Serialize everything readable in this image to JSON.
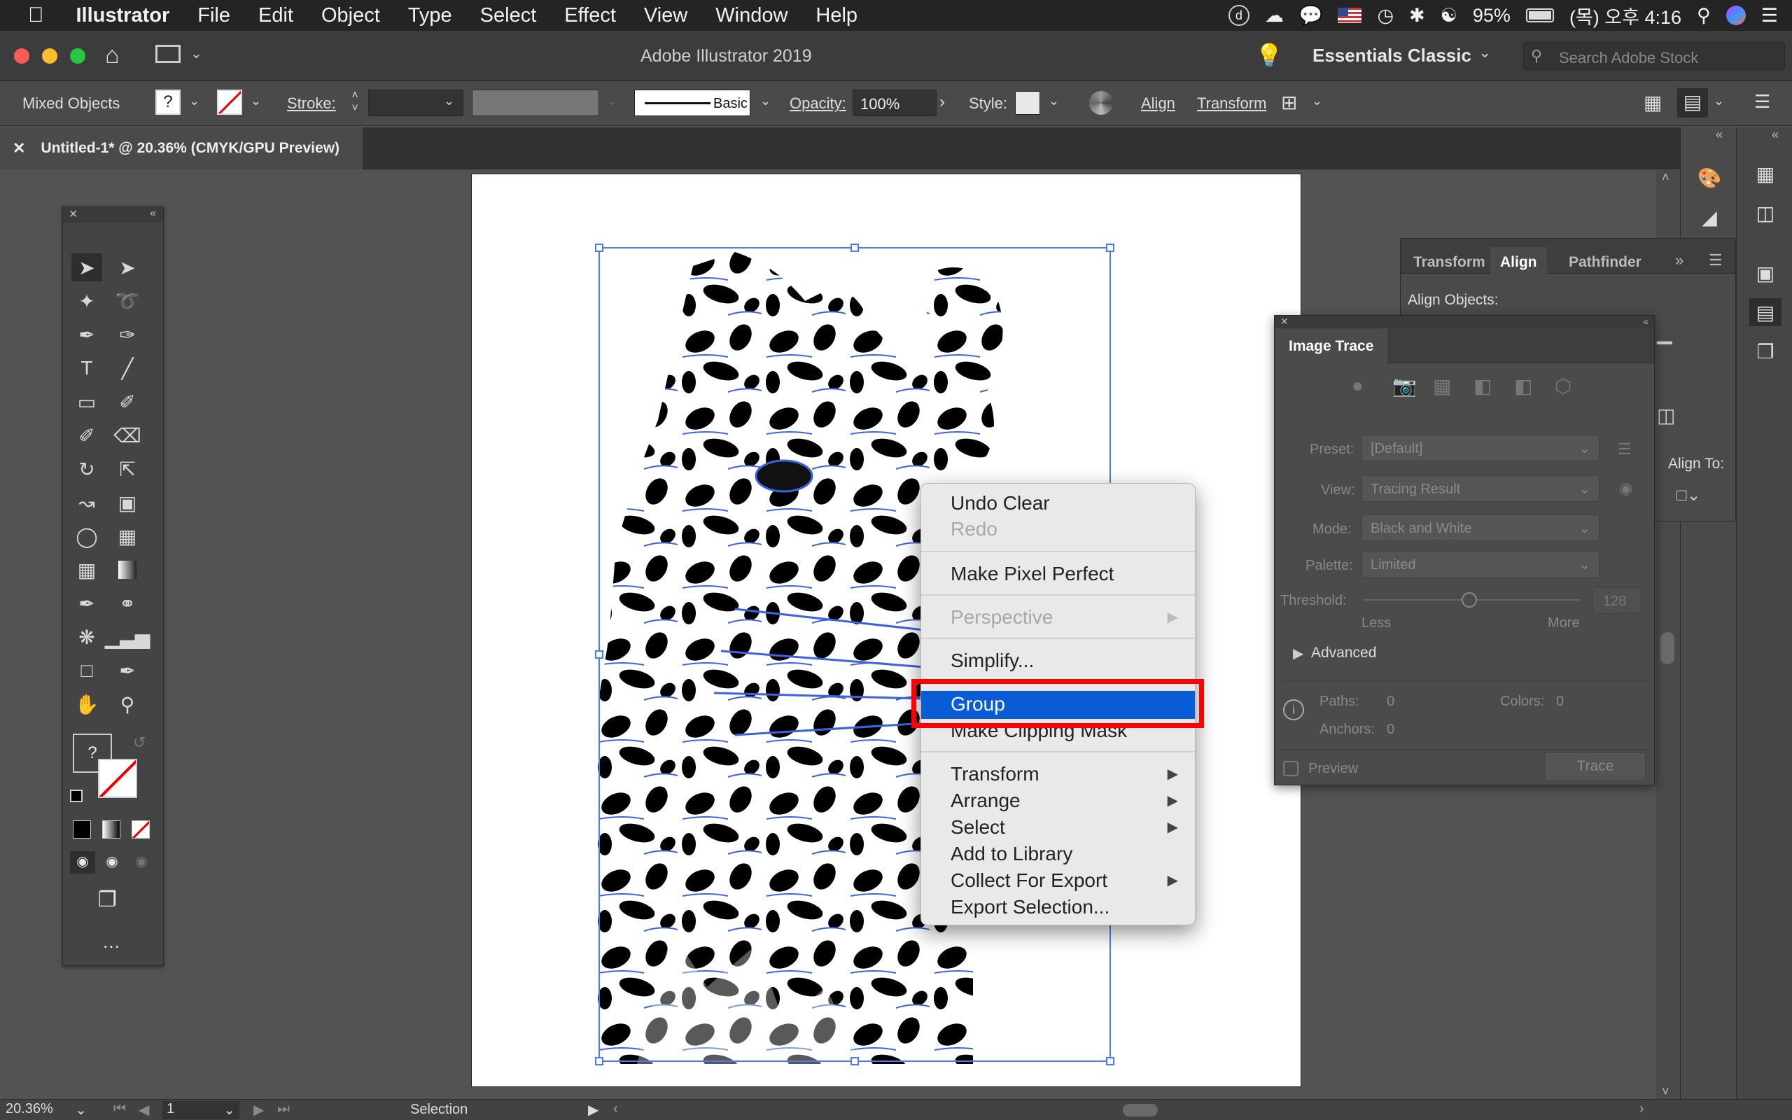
{
  "menubar": {
    "app": "Illustrator",
    "items": [
      "File",
      "Edit",
      "Object",
      "Type",
      "Select",
      "Effect",
      "View",
      "Window",
      "Help"
    ],
    "battery": "95%",
    "clock": "(목) 오후 4:16"
  },
  "window": {
    "title": "Adobe Illustrator 2019",
    "workspace": "Essentials Classic",
    "search_placeholder": "Search Adobe Stock"
  },
  "control": {
    "selection_type": "Mixed Objects",
    "stroke_label": "Stroke:",
    "brush": "Basic",
    "opacity_label": "Opacity:",
    "opacity_value": "100%",
    "style_label": "Style:",
    "align": "Align",
    "transform": "Transform"
  },
  "document": {
    "tab_title": "Untitled-1* @ 20.36% (CMYK/GPU Preview)"
  },
  "status": {
    "zoom": "20.36%",
    "artboard": "1",
    "tool": "Selection"
  },
  "align_panel": {
    "tabs": [
      "Transform",
      "Align",
      "Pathfinder"
    ],
    "align_objects": "Align Objects:",
    "align_to": "Align To:"
  },
  "image_trace": {
    "title": "Image Trace",
    "preset_label": "Preset:",
    "preset_value": "[Default]",
    "view_label": "View:",
    "view_value": "Tracing Result",
    "mode_label": "Mode:",
    "mode_value": "Black and White",
    "palette_label": "Palette:",
    "palette_value": "Limited",
    "threshold_label": "Threshold:",
    "threshold_value": "128",
    "threshold_fraction": 0.49,
    "less": "Less",
    "more": "More",
    "advanced": "Advanced",
    "paths_label": "Paths:",
    "paths_value": "0",
    "colors_label": "Colors:",
    "colors_value": "0",
    "anchors_label": "Anchors:",
    "anchors_value": "0",
    "preview": "Preview",
    "trace": "Trace"
  },
  "context_menu": {
    "undo": "Undo Clear",
    "redo": "Redo",
    "pixel": "Make Pixel Perfect",
    "perspective": "Perspective",
    "simplify": "Simplify...",
    "group": "Group",
    "clipping": "Make Clipping Mask",
    "transform": "Transform",
    "arrange": "Arrange",
    "select": "Select",
    "library": "Add to Library",
    "collect": "Collect For Export",
    "export": "Export Selection..."
  },
  "colors": {
    "highlight": "#0a5bd6",
    "annotation": "#ff0000",
    "selection": "#4a7bf0"
  }
}
